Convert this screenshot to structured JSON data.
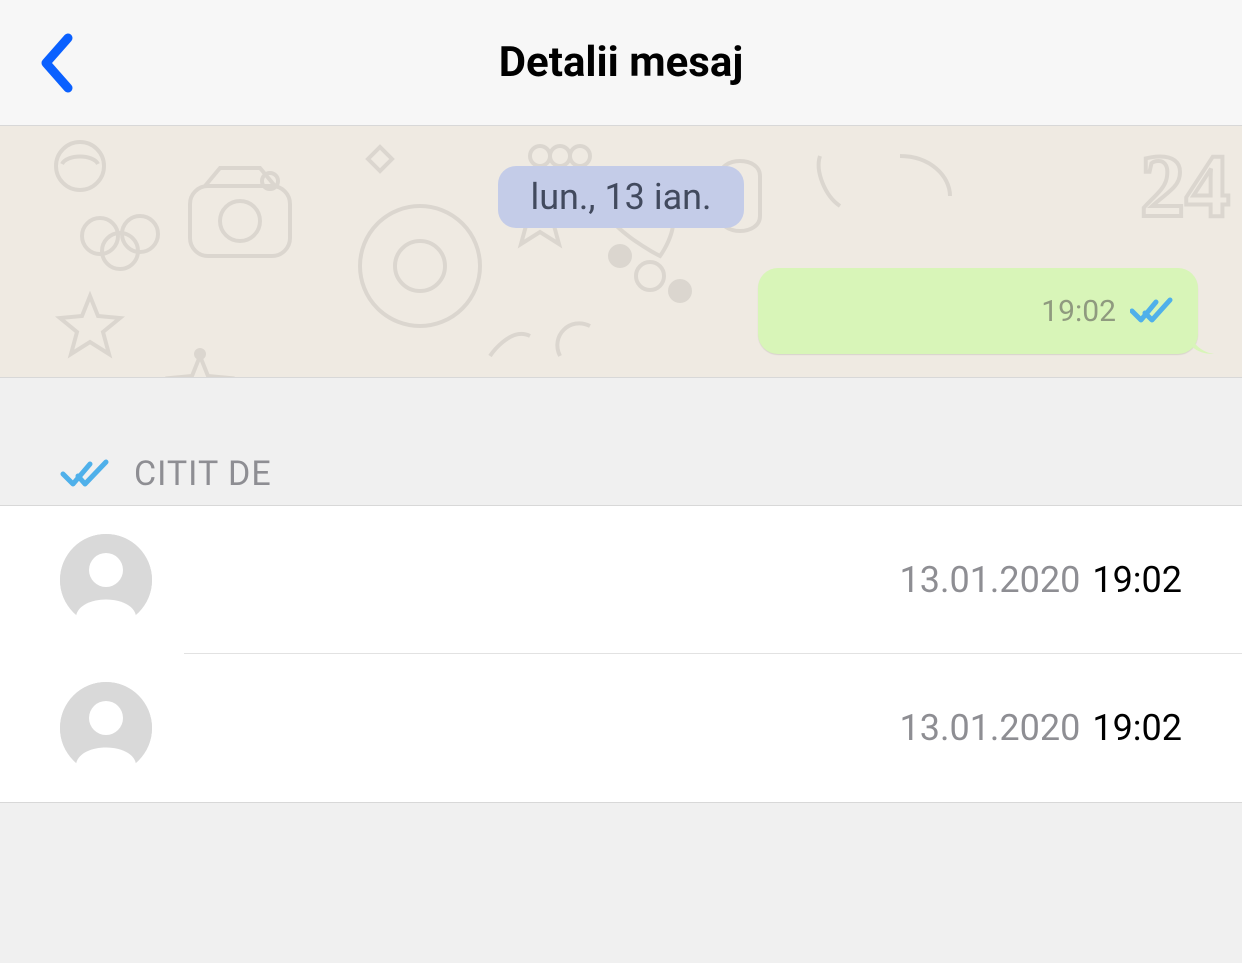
{
  "header": {
    "title": "Detalii mesaj"
  },
  "message": {
    "date_label": "lun., 13 ian.",
    "time": "19:02"
  },
  "read_section": {
    "label": "CITIT DE",
    "entries": [
      {
        "date": "13.01.2020",
        "time": "19:02"
      },
      {
        "date": "13.01.2020",
        "time": "19:02"
      }
    ]
  }
}
